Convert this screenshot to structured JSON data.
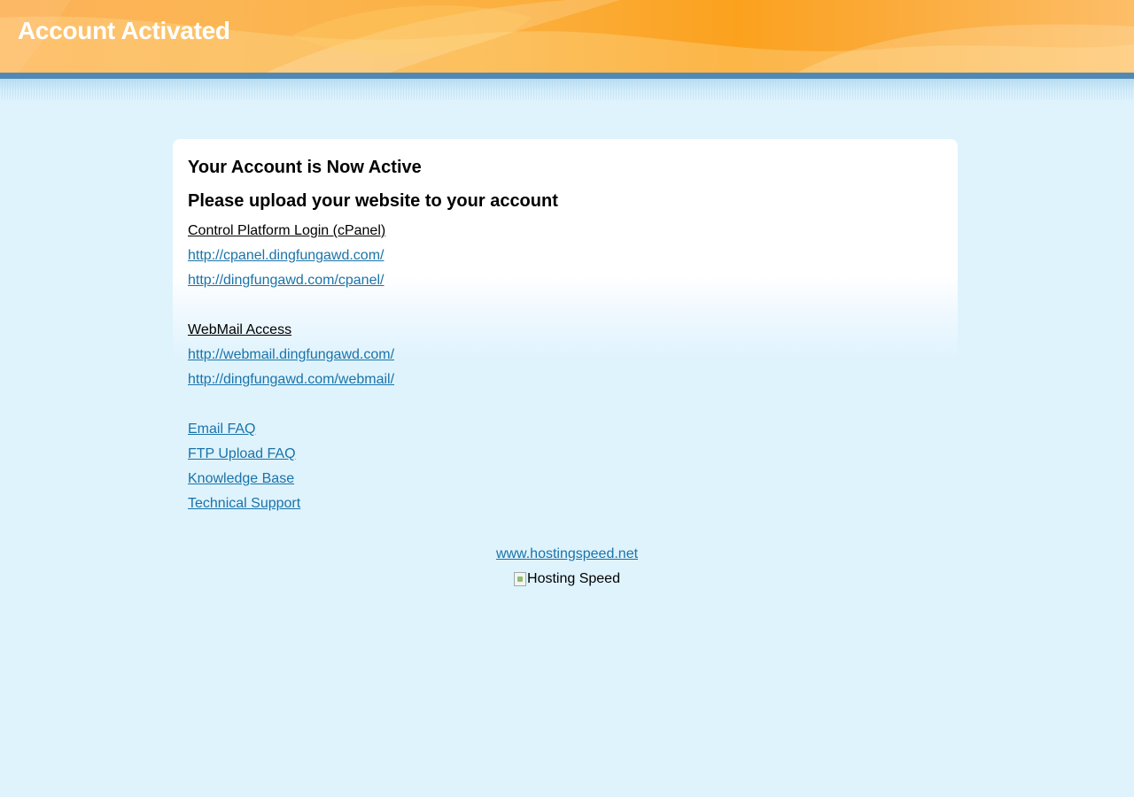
{
  "header": {
    "title": "Account Activated"
  },
  "main": {
    "heading1": "Your Account is Now Active",
    "heading2": "Please upload your website to your account",
    "cpanel": {
      "label": "Control Platform Login (cPanel)",
      "links": [
        "http://cpanel.dingfungawd.com/",
        "http://dingfungawd.com/cpanel/"
      ]
    },
    "webmail": {
      "label": "WebMail Access",
      "links": [
        "http://webmail.dingfungawd.com/",
        "http://dingfungawd.com/webmail/"
      ]
    },
    "help_links": [
      "Email FAQ",
      "FTP Upload FAQ",
      "Knowledge Base",
      "Technical Support"
    ]
  },
  "footer": {
    "site_link": "www.hostingspeed.net",
    "logo_alt": "Hosting Speed",
    "logo_icon": "broken-image-icon"
  },
  "colors": {
    "header_orange": "#fba11e",
    "header_stripe": "#5189b4",
    "page_background": "#dff3fd",
    "link": "#1a73a8"
  }
}
